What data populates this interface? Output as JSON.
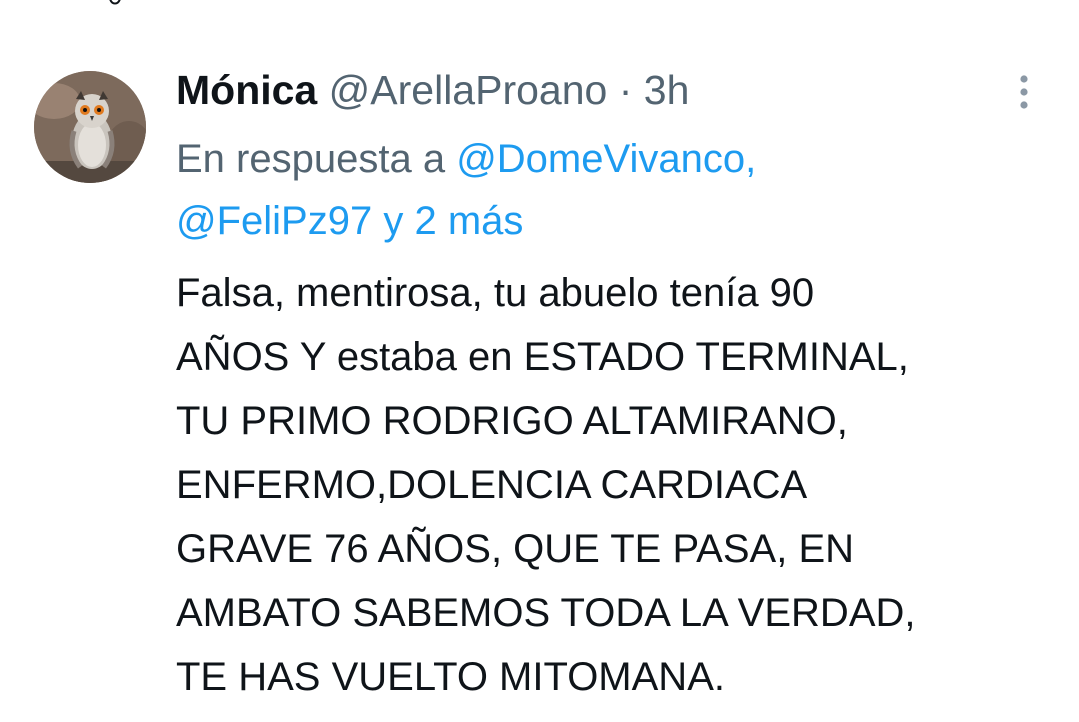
{
  "tweet": {
    "author_name": "Mónica",
    "handle": "@ArellaProano",
    "separator": " · ",
    "time": "3h",
    "reply": {
      "prefix": "En respuesta a ",
      "mention_1": "@DomeVivanco,",
      "mention_2": "@FeliPz97",
      "connector": " y ",
      "more": "2 más"
    },
    "body_lines": [
      "Falsa, mentirosa, tu abuelo tenía 90",
      "AÑOS Y estaba en ESTADO TERMINAL,",
      "TU PRIMO RODRIGO ALTAMIRANO,",
      "ENFERMO,DOLENCIA CARDIACA",
      "GRAVE 76 AÑOS, QUE TE PASA, EN",
      "AMBATO SABEMOS TODA LA VERDAD,",
      "TE HAS VUELTO MITOMANA."
    ]
  },
  "icons": {
    "avatar": "owl-avatar",
    "more": "more-vertical-icon"
  },
  "colors": {
    "text": "#0f1419",
    "secondary": "#536471",
    "link": "#1d9bf0",
    "background": "#ffffff"
  }
}
